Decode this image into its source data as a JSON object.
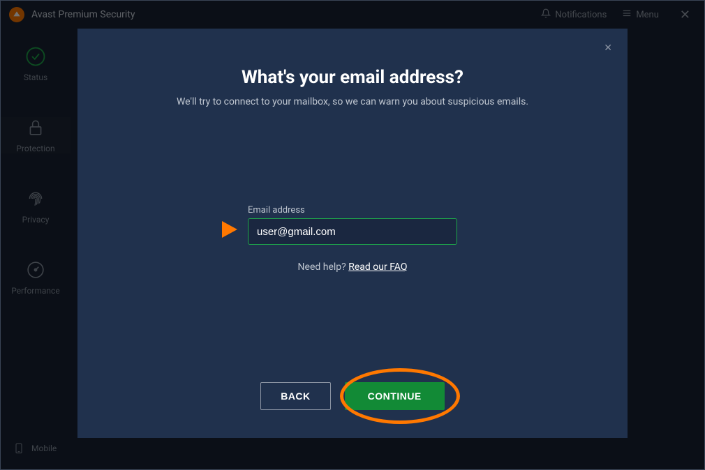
{
  "window": {
    "title": "Avast Premium Security"
  },
  "titlebar": {
    "notifications_label": "Notifications",
    "menu_label": "Menu"
  },
  "sidebar": {
    "items": [
      {
        "label": "Status"
      },
      {
        "label": "Protection"
      },
      {
        "label": "Privacy"
      },
      {
        "label": "Performance"
      }
    ],
    "bottom": {
      "label": "Mobile"
    }
  },
  "modal": {
    "title": "What's your email address?",
    "subtitle": "We'll try to connect to your mailbox, so we can warn you about suspicious emails.",
    "field_label": "Email address",
    "email_value": "user@gmail.com",
    "help_prefix": "Need help? ",
    "help_link": "Read our FAQ",
    "back_label": "BACK",
    "continue_label": "CONTINUE"
  }
}
